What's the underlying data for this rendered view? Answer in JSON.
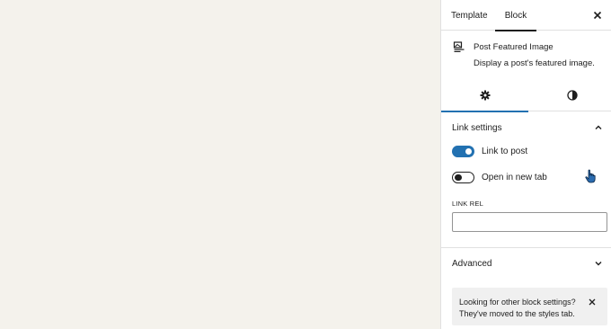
{
  "tabs": {
    "template_label": "Template",
    "block_label": "Block",
    "close_icon": "close-icon"
  },
  "block_card": {
    "icon": "post-featured-image-icon",
    "title": "Post Featured Image",
    "description": "Display a post's featured image."
  },
  "subtabs": {
    "settings_icon": "gear-icon",
    "styles_icon": "half-circle-contrast-icon",
    "active": "settings"
  },
  "link_settings": {
    "title": "Link settings",
    "link_to_post": {
      "label": "Link to post",
      "checked": true
    },
    "open_new_tab": {
      "label": "Open in new tab",
      "checked": false
    },
    "link_rel": {
      "label": "LINK REL",
      "value": ""
    }
  },
  "advanced": {
    "title": "Advanced"
  },
  "notice": {
    "text": "Looking for other block settings? They've moved to the styles tab."
  },
  "colors": {
    "accent": "#2271b1",
    "canvas": "#f4f2ec",
    "notice_bg": "#f0f0f0"
  }
}
